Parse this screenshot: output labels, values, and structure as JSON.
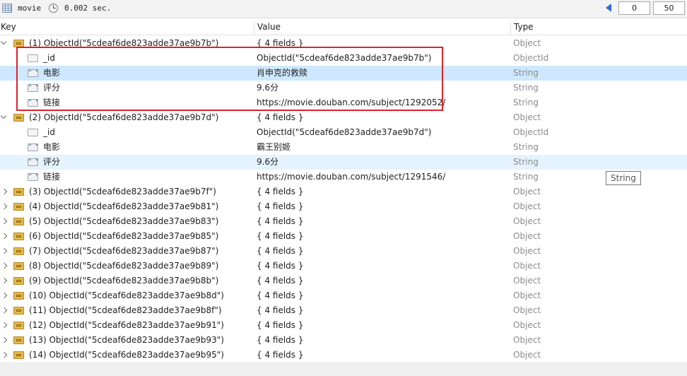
{
  "toolbar": {
    "collection": "movie",
    "query_time": "0.002 sec.",
    "skip": "0",
    "limit": "50"
  },
  "columns": {
    "key": "Key",
    "value": "Value",
    "type": "Type"
  },
  "rows": [
    {
      "level": 0,
      "expanded": true,
      "icon": "document-icon",
      "key": "(1) ObjectId(\"5cdeaf6de823adde37ae9b7b\")",
      "value": "{ 4 fields }",
      "type": "Object"
    },
    {
      "level": 1,
      "icon": "objectid-icon",
      "key": "_id",
      "value": "ObjectId(\"5cdeaf6de823adde37ae9b7b\")",
      "type": "ObjectId"
    },
    {
      "level": 1,
      "icon": "string-icon",
      "key": "电影",
      "value": "肖申克的救赎",
      "type": "String",
      "state": "selected"
    },
    {
      "level": 1,
      "icon": "string-icon",
      "key": "评分",
      "value": "9.6分",
      "type": "String"
    },
    {
      "level": 1,
      "icon": "string-icon",
      "key": "链接",
      "value": "https://movie.douban.com/subject/1292052/",
      "type": "String"
    },
    {
      "level": 0,
      "expanded": true,
      "icon": "document-icon",
      "key": "(2) ObjectId(\"5cdeaf6de823adde37ae9b7d\")",
      "value": "{ 4 fields }",
      "type": "Object"
    },
    {
      "level": 1,
      "icon": "objectid-icon",
      "key": "_id",
      "value": "ObjectId(\"5cdeaf6de823adde37ae9b7d\")",
      "type": "ObjectId"
    },
    {
      "level": 1,
      "icon": "string-icon",
      "key": "电影",
      "value": "霸王别姬",
      "type": "String"
    },
    {
      "level": 1,
      "icon": "string-icon",
      "key": "评分",
      "value": "9.6分",
      "type": "String",
      "state": "hover"
    },
    {
      "level": 1,
      "icon": "string-icon",
      "key": "链接",
      "value": "https://movie.douban.com/subject/1291546/",
      "type": "String"
    },
    {
      "level": 0,
      "expanded": false,
      "icon": "document-icon",
      "key": "(3) ObjectId(\"5cdeaf6de823adde37ae9b7f\")",
      "value": "{ 4 fields }",
      "type": "Object"
    },
    {
      "level": 0,
      "expanded": false,
      "icon": "document-icon",
      "key": "(4) ObjectId(\"5cdeaf6de823adde37ae9b81\")",
      "value": "{ 4 fields }",
      "type": "Object"
    },
    {
      "level": 0,
      "expanded": false,
      "icon": "document-icon",
      "key": "(5) ObjectId(\"5cdeaf6de823adde37ae9b83\")",
      "value": "{ 4 fields }",
      "type": "Object"
    },
    {
      "level": 0,
      "expanded": false,
      "icon": "document-icon",
      "key": "(6) ObjectId(\"5cdeaf6de823adde37ae9b85\")",
      "value": "{ 4 fields }",
      "type": "Object"
    },
    {
      "level": 0,
      "expanded": false,
      "icon": "document-icon",
      "key": "(7) ObjectId(\"5cdeaf6de823adde37ae9b87\")",
      "value": "{ 4 fields }",
      "type": "Object"
    },
    {
      "level": 0,
      "expanded": false,
      "icon": "document-icon",
      "key": "(8) ObjectId(\"5cdeaf6de823adde37ae9b89\")",
      "value": "{ 4 fields }",
      "type": "Object"
    },
    {
      "level": 0,
      "expanded": false,
      "icon": "document-icon",
      "key": "(9) ObjectId(\"5cdeaf6de823adde37ae9b8b\")",
      "value": "{ 4 fields }",
      "type": "Object"
    },
    {
      "level": 0,
      "expanded": false,
      "icon": "document-icon",
      "key": "(10) ObjectId(\"5cdeaf6de823adde37ae9b8d\")",
      "value": "{ 4 fields }",
      "type": "Object"
    },
    {
      "level": 0,
      "expanded": false,
      "icon": "document-icon",
      "key": "(11) ObjectId(\"5cdeaf6de823adde37ae9b8f\")",
      "value": "{ 4 fields }",
      "type": "Object"
    },
    {
      "level": 0,
      "expanded": false,
      "icon": "document-icon",
      "key": "(12) ObjectId(\"5cdeaf6de823adde37ae9b91\")",
      "value": "{ 4 fields }",
      "type": "Object"
    },
    {
      "level": 0,
      "expanded": false,
      "icon": "document-icon",
      "key": "(13) ObjectId(\"5cdeaf6de823adde37ae9b93\")",
      "value": "{ 4 fields }",
      "type": "Object"
    },
    {
      "level": 0,
      "expanded": false,
      "icon": "document-icon",
      "key": "(14) ObjectId(\"5cdeaf6de823adde37ae9b95\")",
      "value": "{ 4 fields }",
      "type": "Object"
    }
  ],
  "tooltip": "String",
  "colors": {
    "selected_row": "#cde8ff",
    "hover_row": "#e5f3ff",
    "highlight_box": "#d9232b",
    "type_text": "#8c8c8c"
  }
}
